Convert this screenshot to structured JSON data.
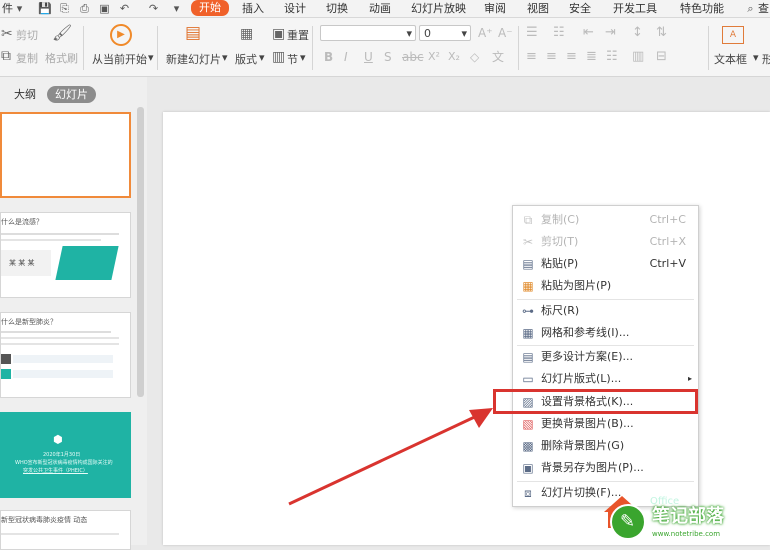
{
  "menubar": {
    "left_text": "件",
    "tabs": [
      "开始",
      "插入",
      "设计",
      "切换",
      "动画",
      "幻灯片放映",
      "审阅",
      "视图",
      "安全",
      "开发工具",
      "特色功能"
    ],
    "active_tab": "开始",
    "search_label": "查"
  },
  "ribbon": {
    "cut": "剪切",
    "copy": "复制",
    "format_painter": "格式刷",
    "from_current": "从当前开始",
    "new_slide": "新建幻灯片",
    "layout": "版式",
    "reset": "重置",
    "section": "节",
    "font_size": "0",
    "textbox": "文本框",
    "shape": "形"
  },
  "leftpanel": {
    "tab_outline": "大纲",
    "tab_slides": "幻灯片"
  },
  "thumbs": {
    "t2_title": "什么是流感？",
    "t2_boxtext": "某 某 某",
    "t3_title": "什么是新型肺炎？",
    "t4_line1": "2020年1月30日",
    "t4_line2": "WHO宣布新型冠状病毒疫情构成国际关注的",
    "t4_line3": "突发公共卫生事件（PHEIC）",
    "t5_title": "新型冠状病毒肺炎疫情   动态"
  },
  "context_menu": {
    "items": [
      {
        "label": "复制(C)",
        "shortcut": "Ctrl+C",
        "icon": "copy-icon",
        "glyph": "⧉",
        "disabled": true
      },
      {
        "label": "剪切(T)",
        "shortcut": "Ctrl+X",
        "icon": "scissors-icon",
        "glyph": "✂",
        "disabled": true
      },
      {
        "label": "粘贴(P)",
        "shortcut": "Ctrl+V",
        "icon": "paste-icon",
        "glyph": "📋",
        "disabled": false
      },
      {
        "label": "粘贴为图片(P)",
        "shortcut": "",
        "icon": "paste-image-icon",
        "glyph": "🖼",
        "disabled": false
      },
      {
        "label": "标尺(R)",
        "shortcut": "",
        "icon": "ruler-icon",
        "glyph": "📏",
        "disabled": false
      },
      {
        "label": "网格和参考线(I)...",
        "shortcut": "",
        "icon": "grid-icon",
        "glyph": "▦",
        "disabled": false
      },
      {
        "label": "更多设计方案(E)...",
        "shortcut": "",
        "icon": "design-icon",
        "glyph": "▤",
        "disabled": false
      },
      {
        "label": "幻灯片版式(L)...",
        "shortcut": "",
        "icon": "layout-icon",
        "glyph": "▭",
        "disabled": false
      },
      {
        "label": "设置背景格式(K)...",
        "shortcut": "",
        "icon": "background-format-icon",
        "glyph": "▨",
        "disabled": false
      },
      {
        "label": "更换背景图片(B)...",
        "shortcut": "",
        "icon": "change-bg-image-icon",
        "glyph": "▧",
        "disabled": false
      },
      {
        "label": "删除背景图片(G)",
        "shortcut": "",
        "icon": "delete-bg-image-icon",
        "glyph": "▩",
        "disabled": false
      },
      {
        "label": "背景另存为图片(P)...",
        "shortcut": "",
        "icon": "save-bg-image-icon",
        "glyph": "💾",
        "disabled": false
      },
      {
        "label": "幻灯片切换(F)...",
        "shortcut": "",
        "icon": "transition-icon",
        "glyph": "⧈",
        "disabled": false
      }
    ]
  },
  "watermark": {
    "text_main": "笔记部落",
    "text_url": "www.notetribe.com",
    "text_office": "Office"
  },
  "colors": {
    "accent": "#f0612a",
    "highlight_box": "#d9342f",
    "arrow": "#d9342f",
    "teal": "#1fb3a4",
    "logo_green": "#3aa52e"
  }
}
